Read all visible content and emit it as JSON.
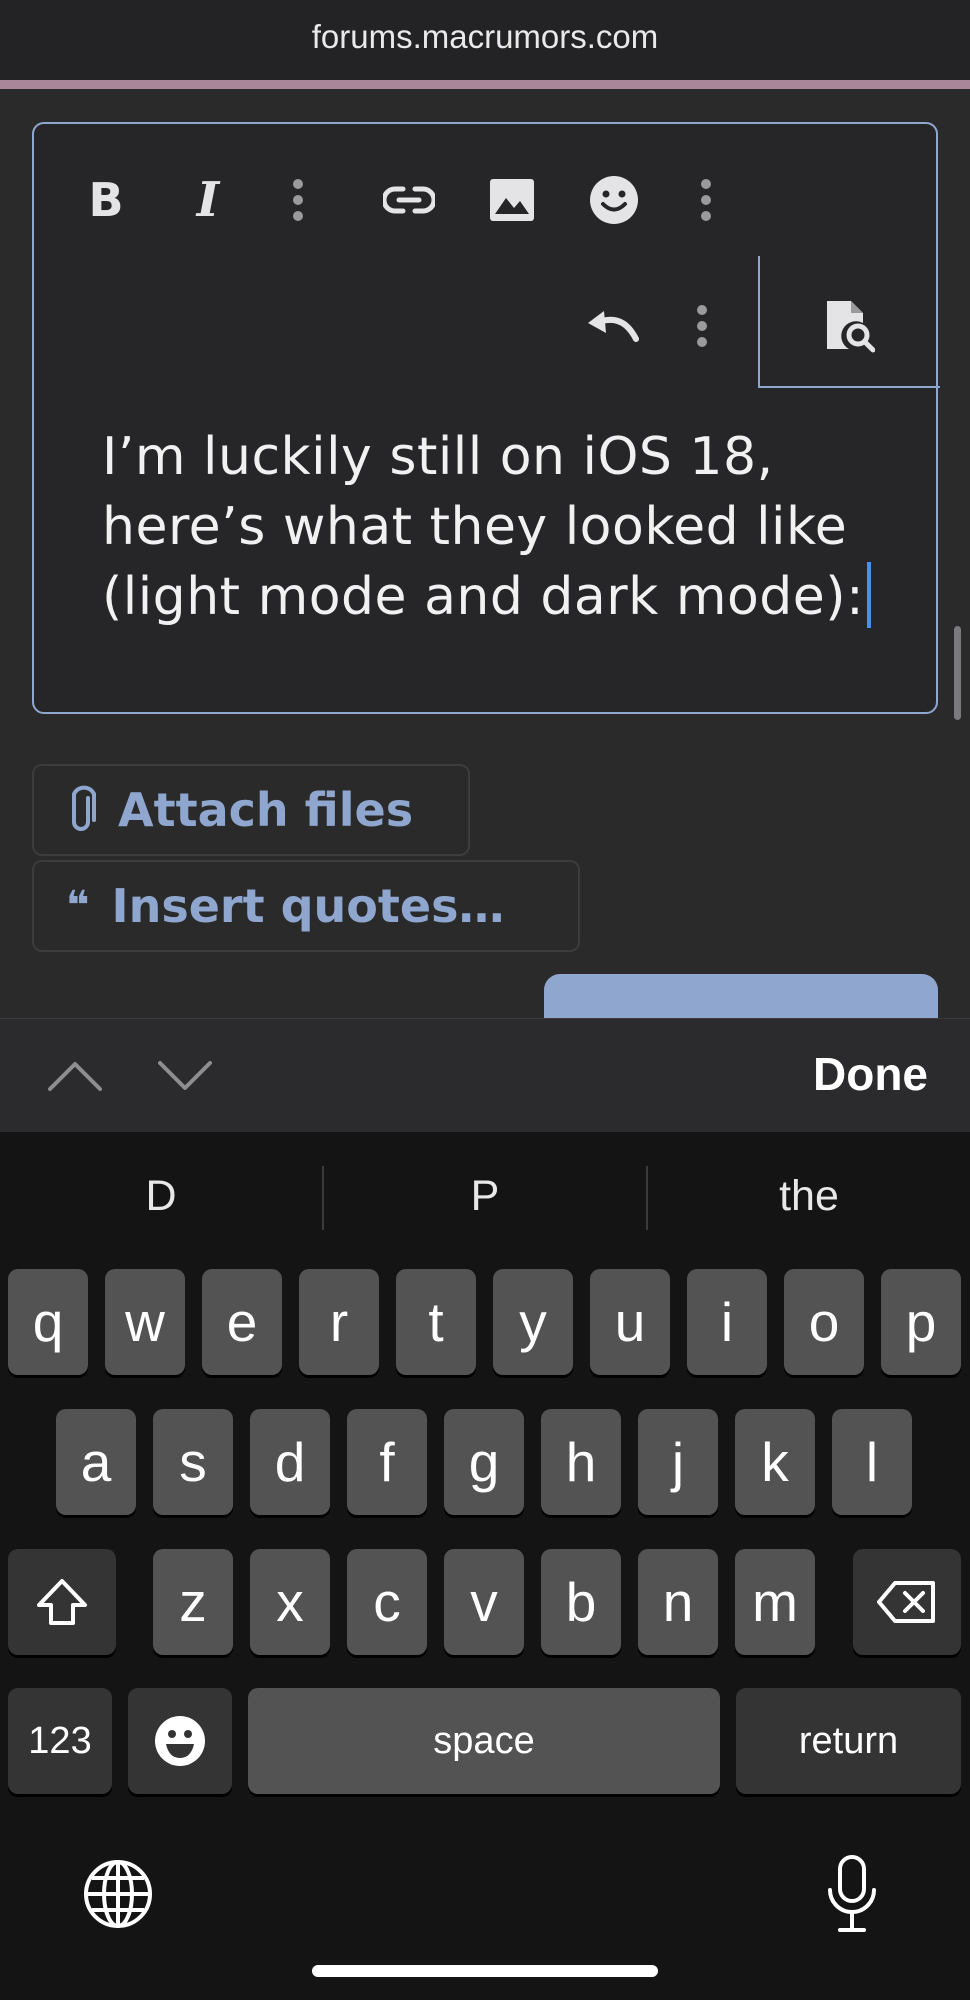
{
  "browser": {
    "url": "forums.macrumors.com"
  },
  "editor": {
    "toolbar": [
      {
        "name": "bold",
        "glyph": "B"
      },
      {
        "name": "italic",
        "glyph": "I"
      },
      {
        "name": "more-text-options",
        "glyph": "⋮"
      },
      {
        "name": "link",
        "icon": "link-icon"
      },
      {
        "name": "image",
        "icon": "image-icon"
      },
      {
        "name": "emoji",
        "icon": "smiley-icon"
      },
      {
        "name": "more-insert-options",
        "glyph": "⋮"
      },
      {
        "name": "undo",
        "icon": "undo-icon"
      },
      {
        "name": "more-options",
        "glyph": "⋮"
      },
      {
        "name": "preview",
        "icon": "preview-icon"
      }
    ],
    "bold_glyph": "B",
    "italic_glyph": "I",
    "text_lines": [
      "I’m luckily still on iOS 18,",
      "here’s what they looked like",
      "(light mode and dark mode):"
    ]
  },
  "actions": {
    "attach_label": "Attach files",
    "quotes_label": "Insert quotes…",
    "quotes_glyph": "❝"
  },
  "accessory": {
    "done_label": "Done"
  },
  "keyboard": {
    "suggestions": [
      "D",
      "P",
      "the"
    ],
    "row1": [
      "q",
      "w",
      "e",
      "r",
      "t",
      "y",
      "u",
      "i",
      "o",
      "p"
    ],
    "row2": [
      "a",
      "s",
      "d",
      "f",
      "g",
      "h",
      "j",
      "k",
      "l"
    ],
    "row3": [
      "z",
      "x",
      "c",
      "v",
      "b",
      "n",
      "m"
    ],
    "numbers_label": "123",
    "space_label": "space",
    "return_label": "return"
  },
  "colors": {
    "accent": "#8fa7cf",
    "background": "#2a2a2b",
    "key": "#535354",
    "key_dark": "#343435"
  }
}
